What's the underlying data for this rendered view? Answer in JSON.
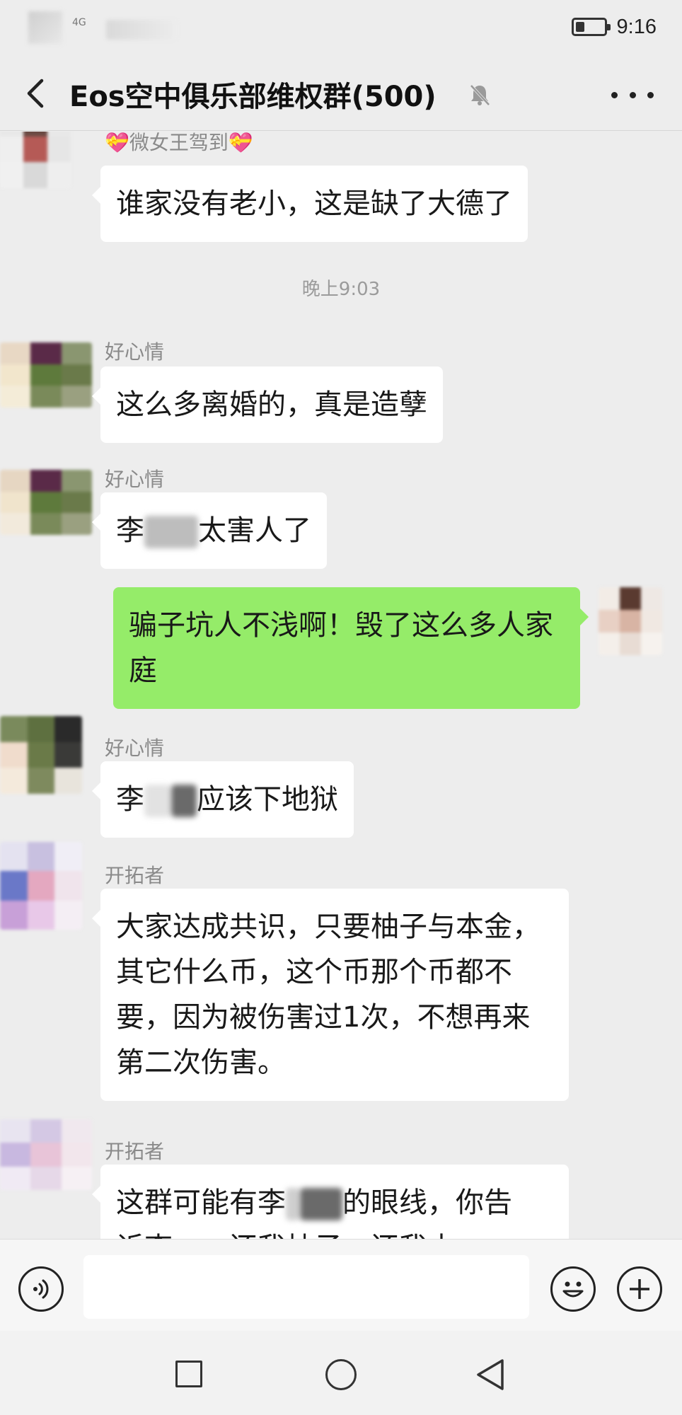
{
  "status_bar": {
    "network_label": "4G",
    "time": "9:16"
  },
  "header": {
    "back_icon": "chevron-left-icon",
    "title": "Eos空中俱乐部维权群(500)",
    "mute_icon": "bell-muted-icon",
    "more_icon": "more-dots-icon"
  },
  "messages": [
    {
      "sender": "💝微女王驾到💝",
      "text": "谁家没有老小，这是缺了大德了"
    },
    {
      "sender": "好心情",
      "text": "这么多离婚的，真是造孽"
    },
    {
      "sender": "好心情",
      "text_before": "李",
      "text_after": "太害人了"
    },
    {
      "side": "right",
      "text": "骗子坑人不浅啊！毁了这么多人家庭"
    },
    {
      "sender": "好心情",
      "text_before": "李",
      "text_after": "应该下地狱"
    },
    {
      "sender": "开拓者",
      "text": "大家达成共识，只要柚子与本金，其它什么币，这个币那个币都不要，因为被伤害过1次，不想再来第二次伤害。"
    },
    {
      "sender": "开拓者",
      "text_line1_before": "这群可能有李",
      "text_line1_after": "的眼线，你告",
      "text_line2": "诉李…，还我柚子，还我本"
    }
  ],
  "time_divider": "晚上9:03",
  "input_bar": {
    "voice_icon": "voice-icon",
    "placeholder": "",
    "emoji_icon": "emoji-icon",
    "plus_icon": "plus-icon"
  },
  "system_nav": {
    "recent_icon": "square-icon",
    "home_icon": "circle-icon",
    "back_icon": "triangle-back-icon"
  }
}
